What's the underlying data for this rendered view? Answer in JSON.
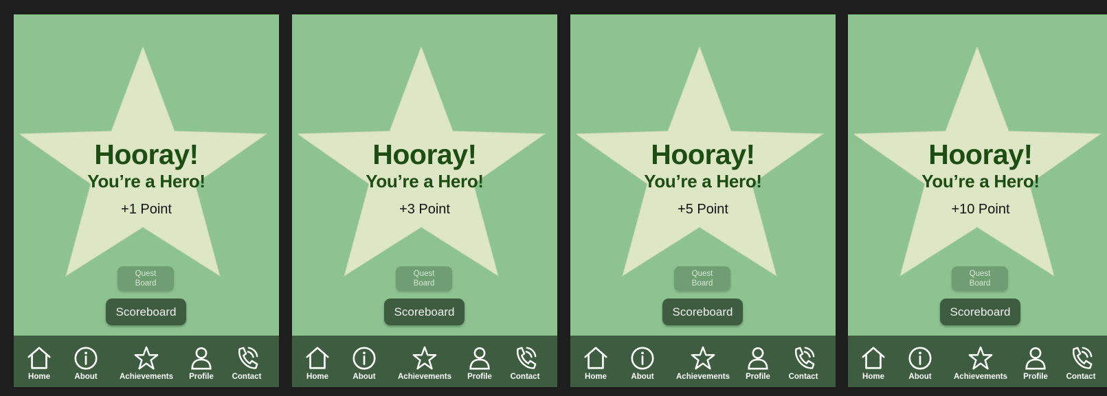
{
  "theme": {
    "frame_bg": "#1e1e1e",
    "screen_bg": "#8dc391",
    "star_fill": "#dde7c6",
    "title_color": "#1e4d14",
    "nav_bg": "#3e5d40",
    "quest_button_bg": "#6f9e73",
    "scoreboard_button_bg": "#3e5d40"
  },
  "screens": [
    {
      "title": "Hooray!",
      "subtitle": "You’re a Hero!",
      "points": "+1 Point",
      "quest_button": "Quest Board",
      "scoreboard_button": "Scoreboard"
    },
    {
      "title": "Hooray!",
      "subtitle": "You’re a Hero!",
      "points": "+3 Point",
      "quest_button": "Quest Board",
      "scoreboard_button": "Scoreboard"
    },
    {
      "title": "Hooray!",
      "subtitle": "You’re a Hero!",
      "points": "+5 Point",
      "quest_button": "Quest Board",
      "scoreboard_button": "Scoreboard"
    },
    {
      "title": "Hooray!",
      "subtitle": "You’re a Hero!",
      "points": "+10 Point",
      "quest_button": "Quest Board",
      "scoreboard_button": "Scoreboard"
    }
  ],
  "nav": [
    {
      "label": "Home",
      "icon": "home-icon"
    },
    {
      "label": "About",
      "icon": "info-icon"
    },
    {
      "label": "Achievements",
      "icon": "star-icon"
    },
    {
      "label": "Profile",
      "icon": "profile-icon"
    },
    {
      "label": "Contact",
      "icon": "phone-icon"
    }
  ]
}
